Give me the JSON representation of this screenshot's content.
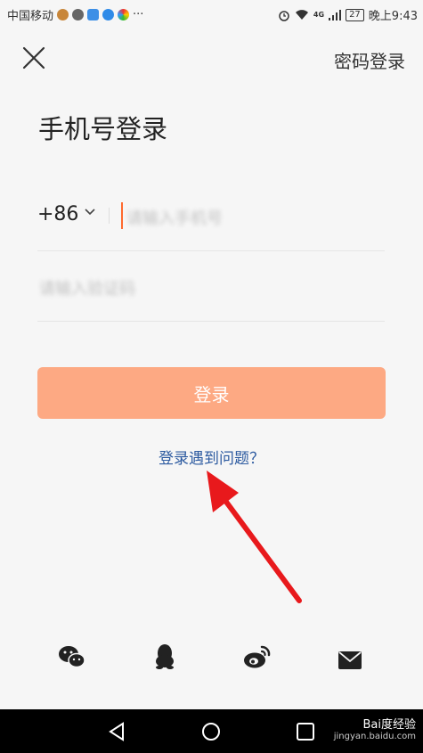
{
  "status_bar": {
    "carrier": "中国移动",
    "network": "4G",
    "battery": "27",
    "time": "晚上9:43"
  },
  "header": {
    "password_login_label": "密码登录"
  },
  "page": {
    "title": "手机号登录"
  },
  "form": {
    "country_code": "+86",
    "phone_placeholder": "请输入手机号",
    "code_placeholder": "请输入验证码"
  },
  "login_button_label": "登录",
  "trouble_link": "登录遇到问题？",
  "social_icons": [
    "wechat-icon",
    "qq-icon",
    "weibo-icon",
    "mail-icon"
  ],
  "watermark": {
    "brand": "Bai度经验",
    "url": "jingyan.baidu.com"
  },
  "colors": {
    "accent": "#fda983",
    "cursor": "#ff6a2e",
    "link": "#2c5aa0",
    "annotation_arrow": "#e8191c"
  }
}
